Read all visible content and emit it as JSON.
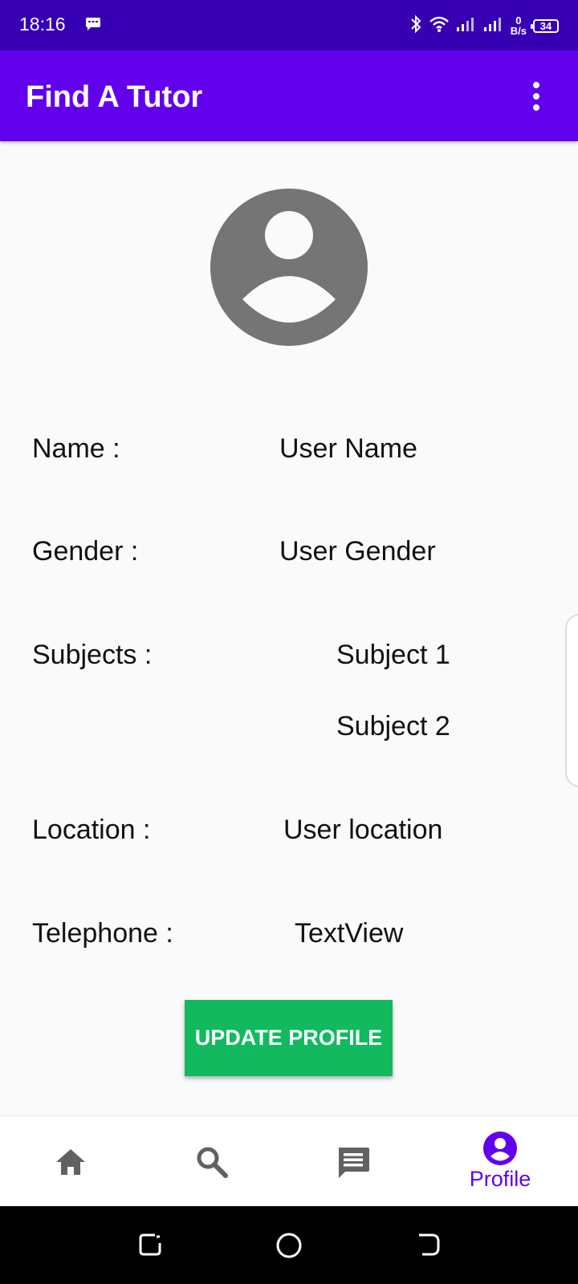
{
  "status_bar": {
    "time": "18:16",
    "net_speed_value": "0",
    "net_speed_unit": "B/s",
    "battery": "34"
  },
  "app_bar": {
    "title": "Find A Tutor"
  },
  "profile": {
    "rows": [
      {
        "label": "Name :",
        "value": "User Name"
      },
      {
        "label": "Gender :",
        "value": "User Gender"
      },
      {
        "label": "Subjects :",
        "value": "Subject 1"
      },
      {
        "label": "",
        "value": "Subject 2"
      },
      {
        "label": "Location :",
        "value": "User location"
      },
      {
        "label": "Telephone :",
        "value": "TextView"
      }
    ],
    "update_button": "UPDATE PROFILE"
  },
  "bottom_nav": {
    "items": [
      {
        "icon": "home-icon",
        "label": ""
      },
      {
        "icon": "search-icon",
        "label": ""
      },
      {
        "icon": "chat-icon",
        "label": ""
      },
      {
        "icon": "account-circle-icon",
        "label": "Profile",
        "selected": true
      }
    ]
  },
  "colors": {
    "status_bar": "#3700b3",
    "app_bar": "#6200ee",
    "button": "#12b95f",
    "nav_selected": "#6200ee",
    "nav_unselected": "#616161",
    "avatar": "#757575"
  }
}
